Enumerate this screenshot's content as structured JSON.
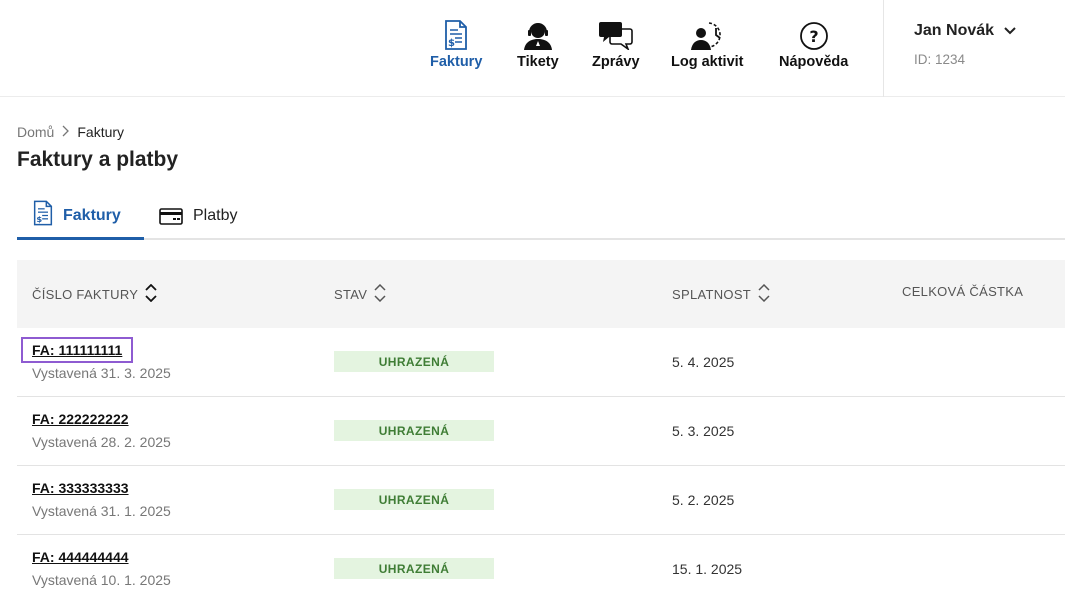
{
  "nav": {
    "items": [
      {
        "label": "Faktury",
        "icon": "invoice-icon",
        "active": true
      },
      {
        "label": "Tikety",
        "icon": "headset-agent-icon"
      },
      {
        "label": "Zprávy",
        "icon": "chat-bubbles-icon"
      },
      {
        "label": "Log aktivit",
        "icon": "activity-log-icon"
      },
      {
        "label": "Nápověda",
        "icon": "help-icon"
      }
    ],
    "accent": "#1f5ea8"
  },
  "user": {
    "name": "Jan Novák",
    "id": "ID: 1234"
  },
  "breadcrumb": {
    "home": "Domů",
    "current": "Faktury"
  },
  "page": {
    "title": "Faktury a platby"
  },
  "tabs": [
    {
      "label": "Faktury",
      "icon": "invoice-icon",
      "active": true
    },
    {
      "label": "Platby",
      "icon": "credit-card-icon"
    }
  ],
  "table": {
    "headers": {
      "number": "ČÍSLO FAKTURY",
      "status": "STAV",
      "due": "SPLATNOST",
      "amount": "CELKOVÁ ČÁSTKA"
    },
    "rows": [
      {
        "number": "FA: 111111111",
        "issued": "Vystavená 31. 3. 2025",
        "status": "UHRAZENÁ",
        "due": "5. 4. 2025"
      },
      {
        "number": "FA: 222222222",
        "issued": "Vystavená 28. 2. 2025",
        "status": "UHRAZENÁ",
        "due": "5. 3. 2025"
      },
      {
        "number": "FA: 333333333",
        "issued": "Vystavená 31. 1. 2025",
        "status": "UHRAZENÁ",
        "due": "5. 2. 2025"
      },
      {
        "number": "FA: 444444444",
        "issued": "Vystavená 10. 1. 2025",
        "status": "UHRAZENÁ",
        "due": "15. 1. 2025"
      }
    ]
  },
  "colors": {
    "paid_bg": "#e4f4e0",
    "paid_text": "#3f7d35",
    "focus": "#8e5bd1"
  }
}
